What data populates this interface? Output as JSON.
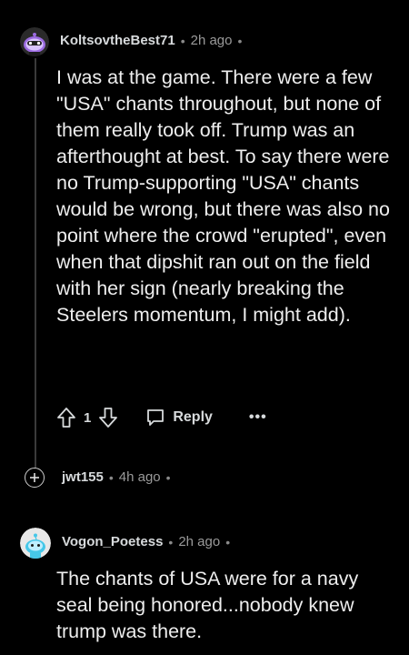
{
  "comments": [
    {
      "username": "KoltsovtheBest71",
      "time": "2h ago",
      "body": "I was at the game. There were a few \"USA\" chants throughout, but none of them really took off. Trump was an afterthought at best. To say there were no Trump-supporting \"USA\" chants would be wrong, but there was also no point where the crowd \"erupted\", even when that dipshit ran out on the field with her sign (nearly breaking the Steelers momentum, I might add).",
      "votes": "1",
      "reply_label": "Reply",
      "more_label": "•••"
    },
    {
      "username": "jwt155",
      "time": "4h ago",
      "collapsed": true,
      "expand_label": "+"
    },
    {
      "username": "Vogon_Poetess",
      "time": "2h ago",
      "body": "The chants of USA were for a navy seal being honored...nobody knew trump was there."
    }
  ],
  "separator": "•",
  "colors": {
    "background": "#000000",
    "text": "#eeeeee",
    "meta": "#9a9a9a",
    "avatar1": "#8e5bd6",
    "avatar3": "#46c7e8"
  },
  "icons": {
    "upvote": "arrow-up-icon",
    "downvote": "arrow-down-icon",
    "reply": "speech-bubble-icon",
    "expand": "plus-icon"
  }
}
